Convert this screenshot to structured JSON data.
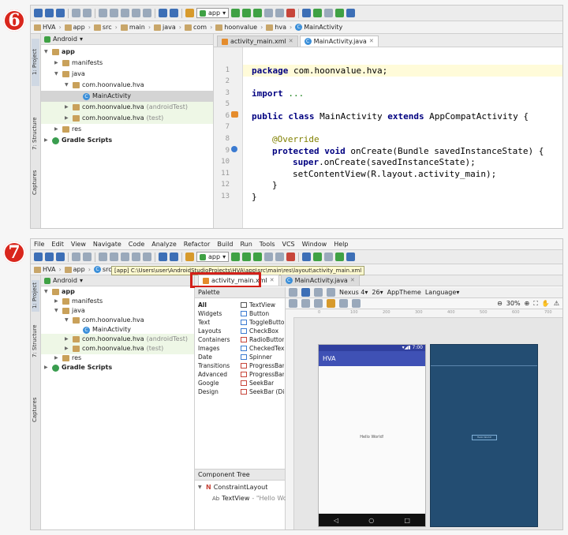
{
  "badges": {
    "first": "6",
    "second": "7"
  },
  "colors": {
    "badge": "#d9261c",
    "highlight_box": "#d32019",
    "appbar": "#3f51b5",
    "blueprint": "#234d72"
  },
  "toolbar": {
    "run_config": "app"
  },
  "shot6": {
    "breadcrumbs": [
      "HVA",
      "app",
      "src",
      "main",
      "java",
      "com",
      "hoonvalue",
      "hva",
      "MainActivity"
    ],
    "project_view": "Android",
    "side_tabs": [
      "1: Project",
      "7: Structure",
      "Captures"
    ],
    "tabs": [
      {
        "label": "activity_main.xml",
        "active": false
      },
      {
        "label": "MainActivity.java",
        "active": true
      }
    ],
    "tree": [
      {
        "label": "app",
        "level": 0,
        "icon": "folder"
      },
      {
        "label": "manifests",
        "level": 1,
        "icon": "folder"
      },
      {
        "label": "java",
        "level": 1,
        "icon": "folder"
      },
      {
        "label": "com.hoonvalue.hva",
        "level": 2,
        "icon": "package"
      },
      {
        "label": "MainActivity",
        "level": 3,
        "icon": "class",
        "selected": true
      },
      {
        "label": "com.hoonvalue.hva",
        "suffix": "(androidTest)",
        "level": 2,
        "icon": "package"
      },
      {
        "label": "com.hoonvalue.hva",
        "suffix": "(test)",
        "level": 2,
        "icon": "package"
      },
      {
        "label": "res",
        "level": 1,
        "icon": "folder"
      },
      {
        "label": "Gradle Scripts",
        "level": 0,
        "icon": "gradle"
      }
    ],
    "line_numbers": [
      "1",
      "2",
      "3",
      "5",
      "6",
      "7",
      "8",
      "9",
      "10",
      "11",
      "12",
      "13"
    ],
    "code": {
      "l1_kw": "package",
      "l1_rest": " com.hoonvalue.hva;",
      "l3_kw": "import",
      "l3_rest": " ...",
      "l6_kw1": "public class",
      "l6_mid": " MainActivity ",
      "l6_kw2": "extends",
      "l6_rest": " AppCompatActivity {",
      "l8": "@Override",
      "l9_kw": "protected void",
      "l9_rest": " onCreate(Bundle savedInstanceState) {",
      "l10_kw": "super",
      "l10_rest": ".onCreate(savedInstanceState);",
      "l11": "setContentView(R.layout.activity_main);",
      "l12": "}",
      "l13": "}"
    }
  },
  "shot7": {
    "menu": [
      "File",
      "Edit",
      "View",
      "Navigate",
      "Code",
      "Analyze",
      "Refactor",
      "Build",
      "Run",
      "Tools",
      "VCS",
      "Window",
      "Help"
    ],
    "breadcrumbs": [
      "HVA",
      "app",
      "src"
    ],
    "tooltip": "[app] C:\\Users\\user\\AndroidStudioProjects\\HVA\\app\\src\\main\\res\\layout\\activity_main.xml",
    "project_view": "Android",
    "tabs": [
      {
        "label": "activity_main.xml",
        "active": true
      },
      {
        "label": "MainActivity.java",
        "active": false
      }
    ],
    "tree": [
      {
        "label": "app",
        "level": 0
      },
      {
        "label": "manifests",
        "level": 1
      },
      {
        "label": "java",
        "level": 1
      },
      {
        "label": "com.hoonvalue.hva",
        "level": 2
      },
      {
        "label": "MainActivity",
        "level": 3
      },
      {
        "label": "com.hoonvalue.hva",
        "suffix": "(androidTest)",
        "level": 2
      },
      {
        "label": "com.hoonvalue.hva",
        "suffix": "(test)",
        "level": 2
      },
      {
        "label": "res",
        "level": 1
      },
      {
        "label": "Gradle Scripts",
        "level": 0
      }
    ],
    "palette_title": "Palette",
    "palette_categories": [
      "All",
      "Widgets",
      "Text",
      "Layouts",
      "Containers",
      "Images",
      "Date",
      "Transitions",
      "Advanced",
      "Google",
      "Design"
    ],
    "palette_items": [
      "TextView",
      "Button",
      "ToggleButton",
      "CheckBox",
      "RadioButton",
      "CheckedTextView",
      "Spinner",
      "ProgressBar",
      "ProgressBar (Horizontal)",
      "SeekBar",
      "SeekBar (Discrete)"
    ],
    "design_toolbar": {
      "device": "Nexus 4",
      "api": "26",
      "theme": "AppTheme",
      "language": "Language",
      "zoom": "30%"
    },
    "ruler_ticks": [
      "0",
      "100",
      "200",
      "300",
      "400",
      "500",
      "600",
      "700"
    ],
    "phone": {
      "status_time": "7:00",
      "app_title": "HVA",
      "hello_text": "Hello World!"
    },
    "component_tree": {
      "title": "Component Tree",
      "root": "ConstraintLayout",
      "child": "TextView",
      "child_text": "- \"Hello World!\""
    }
  }
}
